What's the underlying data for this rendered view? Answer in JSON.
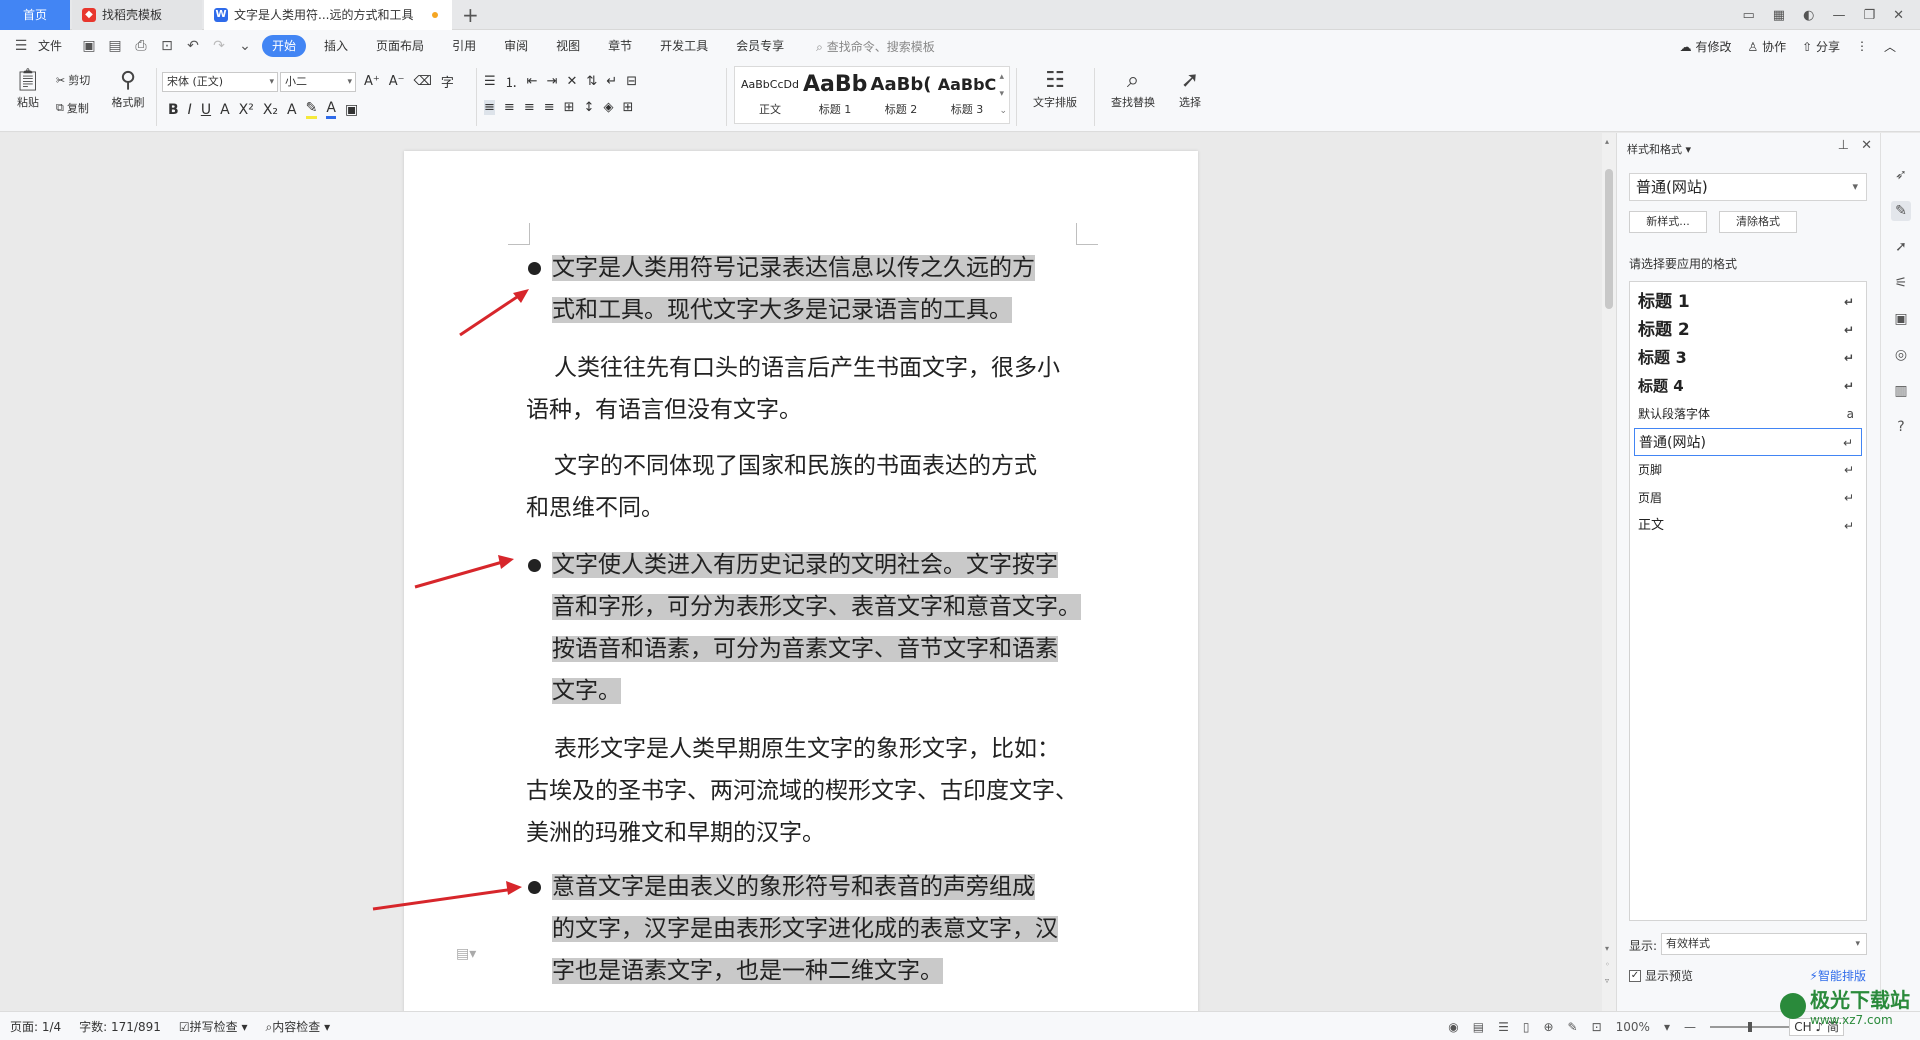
{
  "titlebar": {
    "home_tab": "首页",
    "tab1": "找稻壳模板",
    "tab2": "文字是人类用符...远的方式和工具",
    "tab2_icon": "W"
  },
  "menubar": {
    "file": "文件",
    "items": [
      "开始",
      "插入",
      "页面布局",
      "引用",
      "审阅",
      "视图",
      "章节",
      "开发工具",
      "会员专享"
    ],
    "search": "查找命令、搜索模板",
    "right": [
      "有修改",
      "协作",
      "分享"
    ]
  },
  "ribbon": {
    "paste": "粘贴",
    "cut": "剪切",
    "copy": "复制",
    "format_painter": "格式刷",
    "font_name": "宋体 (正文)",
    "font_size": "小二",
    "styles": [
      {
        "sample": "AaBbCcDd",
        "name": "正文"
      },
      {
        "sample": "AaBb",
        "name": "标题 1"
      },
      {
        "sample": "AaBb(",
        "name": "标题 2"
      },
      {
        "sample": "AaBbC",
        "name": "标题 3"
      }
    ],
    "text_layout": "文字排版",
    "find_replace": "查找替换",
    "select": "选择"
  },
  "document": {
    "p1": "文字是人类用符号记录表达信息以传之久远的方式和工具。现代文字大多是记录语言的工具。",
    "p1_l1": "文字是人类用符号记录表达信息以传之久远的方",
    "p1_l2": "式和工具。现代文字大多是记录语言的工具。",
    "p2_l1": "人类往往先有口头的语言后产生书面文字，很多小",
    "p2_l2": "语种，有语言但没有文字。",
    "p3_l1": "文字的不同体现了国家和民族的书面表达的方式",
    "p3_l2": "和思维不同。",
    "p4_l1": "文字使人类进入有历史记录的文明社会。文字按字",
    "p4_l2": "音和字形，可分为表形文字、表音文字和意音文字。",
    "p4_l3": "按语音和语素，可分为音素文字、音节文字和语素",
    "p4_l4": "文字。",
    "p5_l1": "表形文字是人类早期原生文字的象形文字，比如：",
    "p5_l2": "古埃及的圣书字、两河流域的楔形文字、古印度文字、",
    "p5_l3": "美洲的玛雅文和早期的汉字。",
    "p6_l1": "意音文字是由表义的象形符号和表音的声旁组成",
    "p6_l2": "的文字，汉字是由表形文字进化成的表意文字，汉",
    "p6_l3": "字也是语素文字，也是一种二维文字。"
  },
  "panel": {
    "title": "样式和格式",
    "current_style": "普通(网站)",
    "new_style": "新样式...",
    "clear_format": "清除格式",
    "pick_label": "请选择要应用的格式",
    "styles": [
      {
        "name": "标题  1",
        "mark": "↵"
      },
      {
        "name": "标题  2",
        "mark": "↵"
      },
      {
        "name": "标题  3",
        "mark": "↵"
      },
      {
        "name": "标题  4",
        "mark": "↵"
      },
      {
        "name": "默认段落字体",
        "mark": "a"
      },
      {
        "name": "普通(网站)",
        "mark": "↵"
      },
      {
        "name": "页脚",
        "mark": "↵"
      },
      {
        "name": "页眉",
        "mark": "↵"
      },
      {
        "name": "正文",
        "mark": "↵"
      }
    ],
    "show_label": "显示:",
    "show_value": "有效样式",
    "preview": "显示预览",
    "smart_layout": "智能排版"
  },
  "statusbar": {
    "page": "页面: 1/4",
    "words": "字数: 171/891",
    "spell": "拼写检查",
    "content_check": "内容检查",
    "zoom": "100%",
    "ime": "CH ♪ 简"
  },
  "watermark": {
    "text": "极光下载站",
    "sub": "www.xz7.com"
  },
  "colors": {
    "accent": "#4285f4",
    "highlight": "#c9c9c9",
    "arrow": "#d7262b"
  }
}
